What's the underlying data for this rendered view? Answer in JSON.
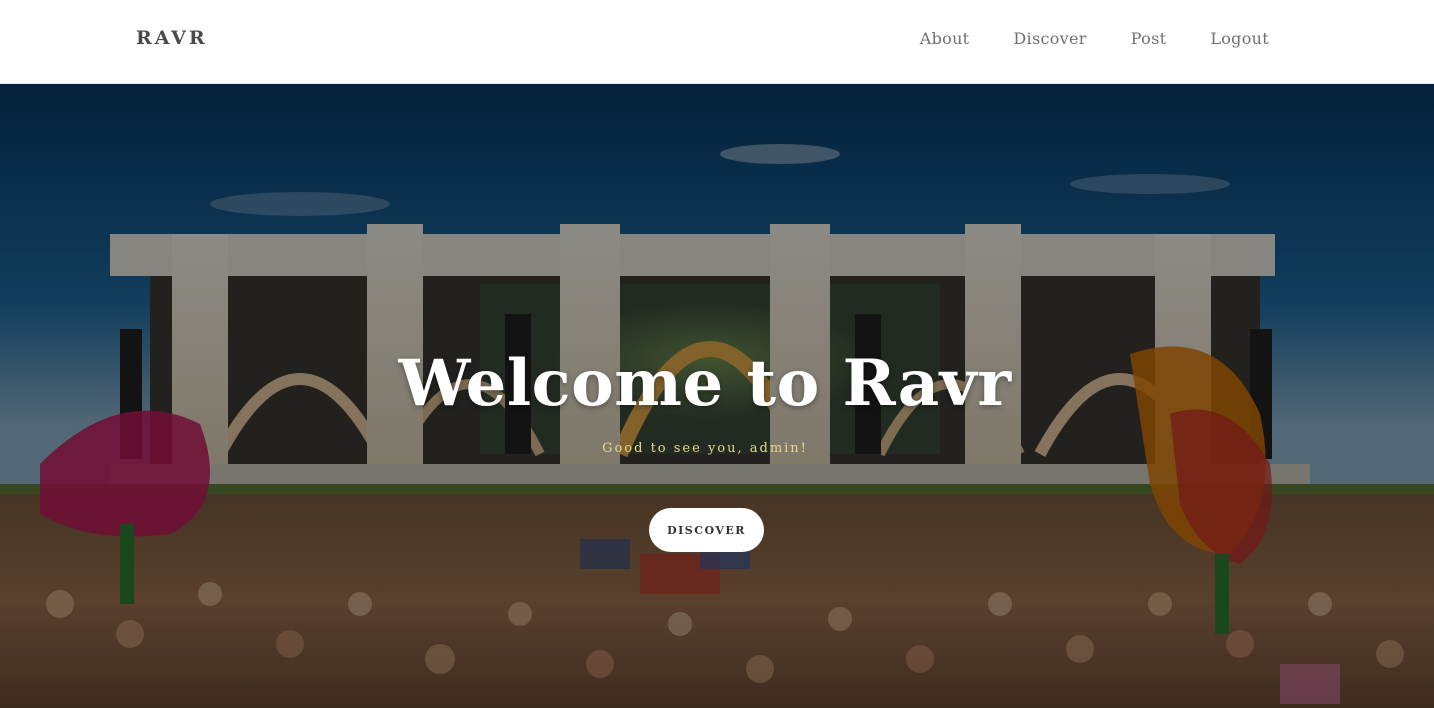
{
  "navbar": {
    "brand": "RAVR",
    "links": [
      {
        "label": "About"
      },
      {
        "label": "Discover"
      },
      {
        "label": "Post"
      },
      {
        "label": "Logout"
      }
    ]
  },
  "hero": {
    "title": "Welcome to Ravr",
    "subtitle": "Good to see you, admin!",
    "button_label": "DISCOVER",
    "background_image": "festival-crowd-stage-photo"
  },
  "colors": {
    "brand_text": "#4a4a4a",
    "nav_text": "#707070",
    "subtitle_text": "#e8d98a",
    "button_bg": "#ffffff"
  }
}
